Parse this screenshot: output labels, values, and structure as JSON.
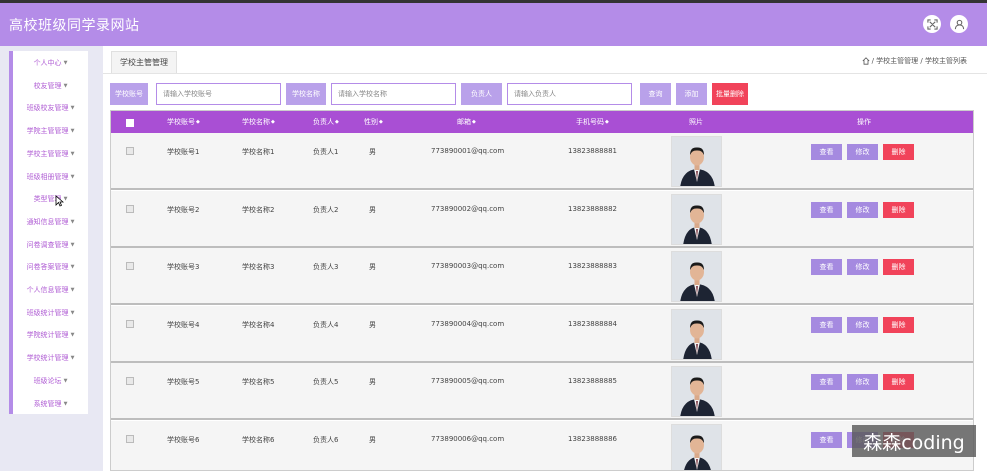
{
  "app": {
    "title": "高校班级同学录网站"
  },
  "header_icons": [
    "fullscreen-icon",
    "user-icon"
  ],
  "sidebar": {
    "items": [
      {
        "label": "个人中心"
      },
      {
        "label": "校友管理"
      },
      {
        "label": "班级校友管理"
      },
      {
        "label": "学院主管管理"
      },
      {
        "label": "学校主管管理"
      },
      {
        "label": "班级相册管理"
      },
      {
        "label": "类型管理"
      },
      {
        "label": "通知信息管理"
      },
      {
        "label": "问卷调查管理"
      },
      {
        "label": "问卷答案管理"
      },
      {
        "label": "个人信息管理"
      },
      {
        "label": "班级统计管理"
      },
      {
        "label": "学院统计管理"
      },
      {
        "label": "学校统计管理"
      },
      {
        "label": "班级论坛"
      },
      {
        "label": "系统管理"
      }
    ]
  },
  "tab": {
    "label": "学校主管管理"
  },
  "breadcrumb": {
    "text": "/ 学校主管管理 / 学校主管列表"
  },
  "search": {
    "account_label": "学校账号",
    "account_placeholder": "请输入学校账号",
    "name_label": "学校名称",
    "name_placeholder": "请输入学校名称",
    "person_label": "负责人",
    "person_placeholder": "请输入负责人",
    "query": "查询",
    "add": "添加",
    "batch_delete": "批量删除"
  },
  "table": {
    "headers": [
      "学校账号",
      "学校名称",
      "负责人",
      "性别",
      "邮箱",
      "手机号码",
      "照片",
      "操作"
    ],
    "actions": {
      "view": "查看",
      "edit": "修改",
      "delete": "删除"
    },
    "rows": [
      {
        "account": "学校账号1",
        "name": "学校名称1",
        "person": "负责人1",
        "gender": "男",
        "email": "773890001@qq.com",
        "phone": "13823888881"
      },
      {
        "account": "学校账号2",
        "name": "学校名称2",
        "person": "负责人2",
        "gender": "男",
        "email": "773890002@qq.com",
        "phone": "13823888882"
      },
      {
        "account": "学校账号3",
        "name": "学校名称3",
        "person": "负责人3",
        "gender": "男",
        "email": "773890003@qq.com",
        "phone": "13823888883"
      },
      {
        "account": "学校账号4",
        "name": "学校名称4",
        "person": "负责人4",
        "gender": "男",
        "email": "773890004@qq.com",
        "phone": "13823888884"
      },
      {
        "account": "学校账号5",
        "name": "学校名称5",
        "person": "负责人5",
        "gender": "男",
        "email": "773890005@qq.com",
        "phone": "13823888885"
      },
      {
        "account": "学校账号6",
        "name": "学校名称6",
        "person": "负责人6",
        "gender": "男",
        "email": "773890006@qq.com",
        "phone": "13823888886"
      }
    ]
  },
  "watermark": {
    "text": "森森coding"
  },
  "colors": {
    "primary": "#b48ce8",
    "header": "#a94fd4",
    "danger": "#f1435a",
    "button": "#a58ae0"
  }
}
